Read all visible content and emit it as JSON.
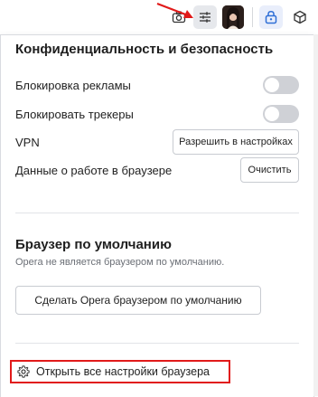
{
  "toolbar": {
    "icons": [
      "camera-icon",
      "easy-setup-icon",
      "profile-avatar",
      "lock-extension-icon",
      "cube-extension-icon"
    ],
    "avatar_bg": "#3a2a24",
    "active_extension_color": "#2f6fd6",
    "annotation_arrow_color": "#e11a1a"
  },
  "privacy": {
    "title": "Конфиденциальность и безопасность",
    "ad_block_label": "Блокировка рекламы",
    "ad_block_enabled": false,
    "tracker_block_label": "Блокировать трекеры",
    "tracker_block_enabled": false,
    "vpn_label": "VPN",
    "vpn_button": "Разрешить в настройках",
    "browsing_data_label": "Данные о работе в браузере",
    "clear_button": "Очистить"
  },
  "default_browser": {
    "title": "Браузер по умолчанию",
    "description": "Opera не является браузером по умолчанию.",
    "make_default_button": "Сделать Opera браузером по умолчанию"
  },
  "footer": {
    "open_all_settings": "Открыть все настройки браузера",
    "icon": "gear-icon",
    "highlight_color": "#e11a1a"
  }
}
